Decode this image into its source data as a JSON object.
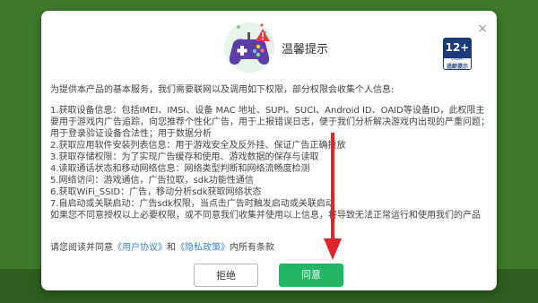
{
  "dialog": {
    "title": "温馨提示",
    "age_rating": {
      "number": "12+",
      "sub": "CADPA",
      "caption": "适龄提示"
    },
    "close_label": "×",
    "intro": "为提供本产品的基本服务，我们需要联网以及调用如下权限，部分权限会收集个人信息:",
    "permissions": [
      "1.获取设备信息：包括IMEI、IMSI、设备 MAC 地址、SUPI、SUCI、Android ID、OAID等设备ID，此权限主要用于游戏内广告追踪，向您推荐个性化广告，用于上报错误日志，便于我们分析解决游戏内出现的严重问题；用于登录验证设备合法性；用于数据分析",
      "2.获取应用软件安装列表信息：用于游戏安全及反外挂、保证广告正确投放",
      "3.获取存储权限：为了实现广告缓存和使用、游戏数据的保存与读取",
      "4.读取通话状态和移动网络信息：网络类型判断和网络流畅度检测",
      "5.网络访问：游戏通信，广告拉取，sdk功能性通信",
      "6.获取WiFi_SSID：广告，移动分析sdk获取网络状态",
      "7.自启动或关联启动：广告sdk权限，当点击广告时触发启动或关联启动",
      "如果您不同意授权以上必要权限，或不同意我们收集并使用以上信息，将导致无法正常运行和使用我们的产品"
    ],
    "consent_prefix": "请您阅读并同意",
    "user_agreement": "《用户协议》",
    "consent_and": "和",
    "privacy_policy": "《隐私政策》",
    "consent_suffix": "内所有条款",
    "decline_label": "拒绝",
    "agree_label": "同意"
  },
  "colors": {
    "agree": "#22b566",
    "link": "#3a82d6",
    "arrow": "#e0262b",
    "background": "#3f7a2c"
  },
  "icons": {
    "header": "gamepad-alert-icon",
    "close": "close-icon",
    "annotation": "red-arrow-icon"
  }
}
